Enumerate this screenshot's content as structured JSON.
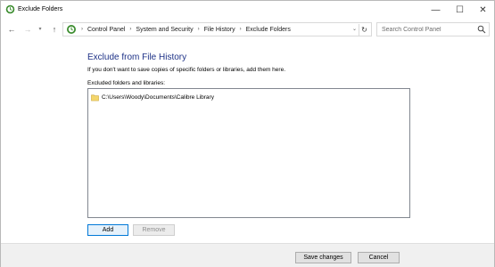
{
  "window": {
    "title": "Exclude Folders",
    "icon": "file-history-icon"
  },
  "titlebar_controls": {
    "minimize": "—",
    "maximize": "☐",
    "close": "✕"
  },
  "nav": {
    "back": "←",
    "forward": "→",
    "recent": "▾",
    "up": "↑"
  },
  "address": {
    "breadcrumbs": [
      "Control Panel",
      "System and Security",
      "File History",
      "Exclude Folders"
    ],
    "separator": "›",
    "dropdown": "⌄",
    "refresh": "↻"
  },
  "search": {
    "placeholder": "Search Control Panel"
  },
  "main": {
    "heading": "Exclude from File History",
    "description": "If you don't want to save copies of specific folders or libraries, add them here.",
    "list_label": "Excluded folders and libraries:",
    "excluded_items": [
      {
        "path": "C:\\Users\\Woody\\Documents\\Calibre Library",
        "icon": "folder-icon"
      }
    ],
    "add_label": "Add",
    "remove_label": "Remove"
  },
  "footer": {
    "save_label": "Save changes",
    "cancel_label": "Cancel"
  },
  "colors": {
    "heading": "#1e3287",
    "folder": "#f4d66b",
    "focus_border": "#0078d7"
  }
}
